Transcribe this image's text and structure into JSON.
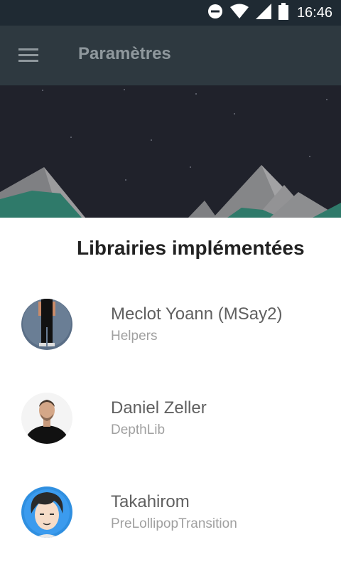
{
  "status_bar": {
    "time": "16:46",
    "icons": [
      "do-not-disturb-icon",
      "wifi-icon",
      "signal-icon",
      "battery-icon"
    ]
  },
  "app_bar": {
    "title": "Paramètres",
    "menu_icon": "hamburger-menu-icon"
  },
  "colors": {
    "status_bar": "#1f2a33",
    "app_bar": "#2e3940",
    "header_bg": "#20222b",
    "mountain_teal": "#2f7a6a",
    "mountain_gray": "#8a8a8a"
  },
  "section": {
    "title": "Librairies implémentées"
  },
  "libraries": [
    {
      "name": "Meclot Yoann (MSay2)",
      "subtitle": "Helpers"
    },
    {
      "name": "Daniel Zeller",
      "subtitle": "DepthLib"
    },
    {
      "name": "Takahirom",
      "subtitle": "PreLollipopTransition"
    }
  ]
}
